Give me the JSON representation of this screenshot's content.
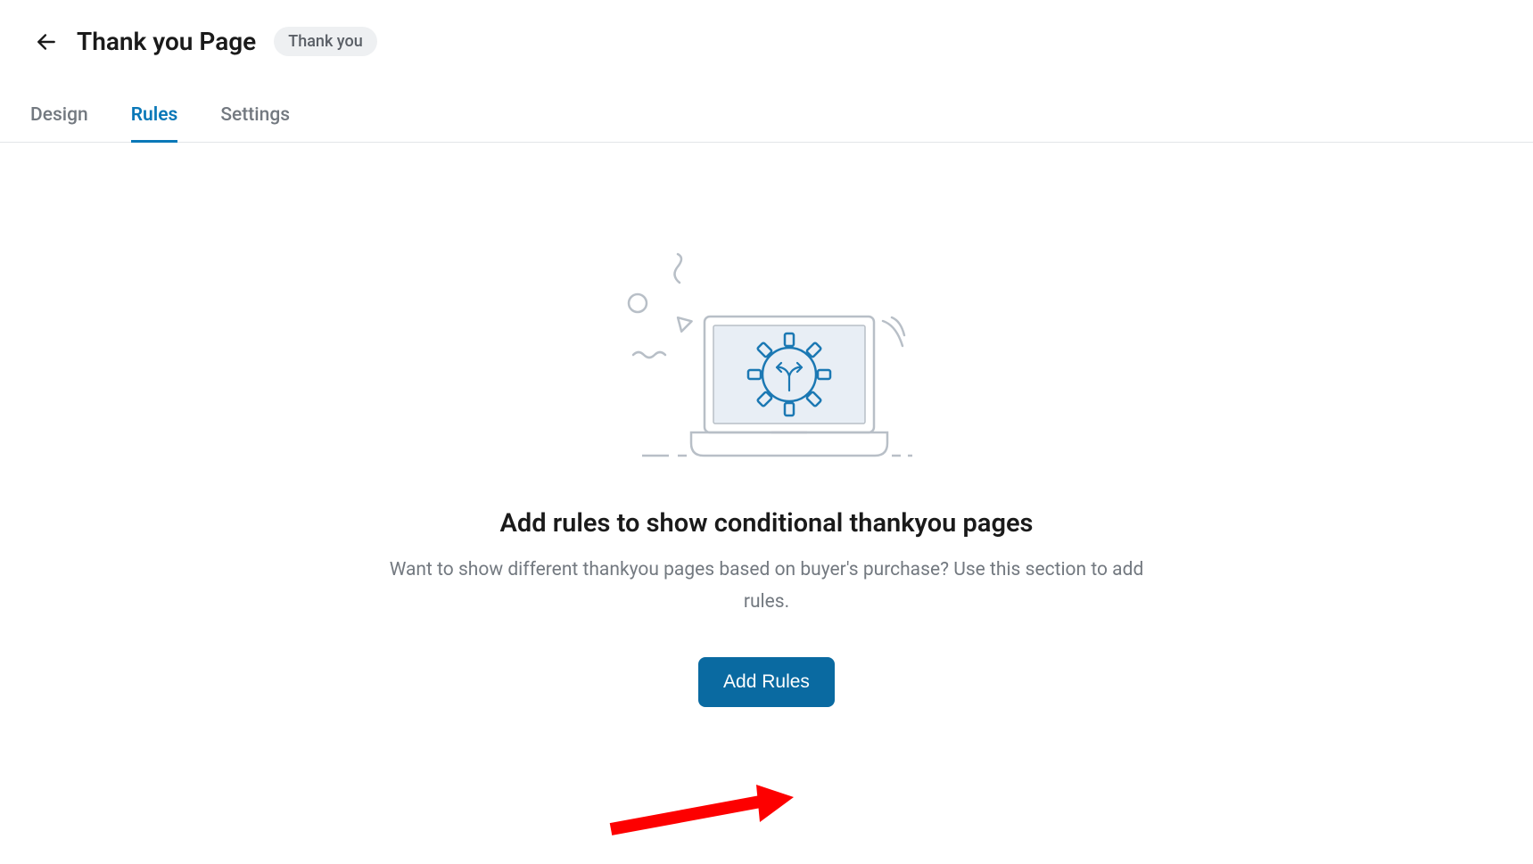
{
  "header": {
    "title": "Thank you Page",
    "badge": "Thank you"
  },
  "tabs": [
    {
      "label": "Design",
      "active": false
    },
    {
      "label": "Rules",
      "active": true
    },
    {
      "label": "Settings",
      "active": false
    }
  ],
  "empty_state": {
    "heading": "Add rules to show conditional thankyou pages",
    "subtext": "Want to show different thankyou pages based on buyer's purchase? Use this section to add rules.",
    "button_label": "Add Rules"
  }
}
